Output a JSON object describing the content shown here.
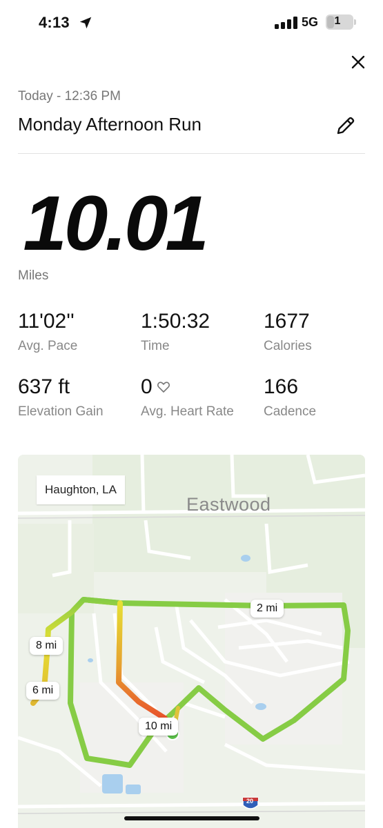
{
  "status_bar": {
    "time": "4:13",
    "network": "5G",
    "battery": "1",
    "icons": [
      "location-arrow-icon",
      "signal-bars-icon",
      "battery-icon"
    ]
  },
  "header": {
    "date": "Today - 12:36 PM",
    "title": "Monday Afternoon Run",
    "icons": [
      "close-icon",
      "pencil-icon"
    ]
  },
  "summary": {
    "distance": "10.01",
    "unit": "Miles"
  },
  "stats": [
    {
      "value": "11'02''",
      "label": "Avg. Pace"
    },
    {
      "value": "1:50:32",
      "label": "Time"
    },
    {
      "value": "1677",
      "label": "Calories"
    },
    {
      "value": "637 ft",
      "label": "Elevation Gain"
    },
    {
      "value": "0",
      "label": "Avg. Heart Rate",
      "icon": "heart-outline-icon"
    },
    {
      "value": "166",
      "label": "Cadence"
    }
  ],
  "map": {
    "location": "Haughton, LA",
    "area": "Eastwood",
    "highway_shield": "20",
    "mile_markers": [
      "2 mi",
      "8 mi",
      "6 mi",
      "10 mi"
    ],
    "colors": {
      "route_fast": "#86cc45",
      "route_mid": "#e6e034",
      "route_slow": "#e8532b",
      "current_position": "#5cc34a",
      "park": "#e4eedc",
      "water": "#a9cfee"
    }
  }
}
